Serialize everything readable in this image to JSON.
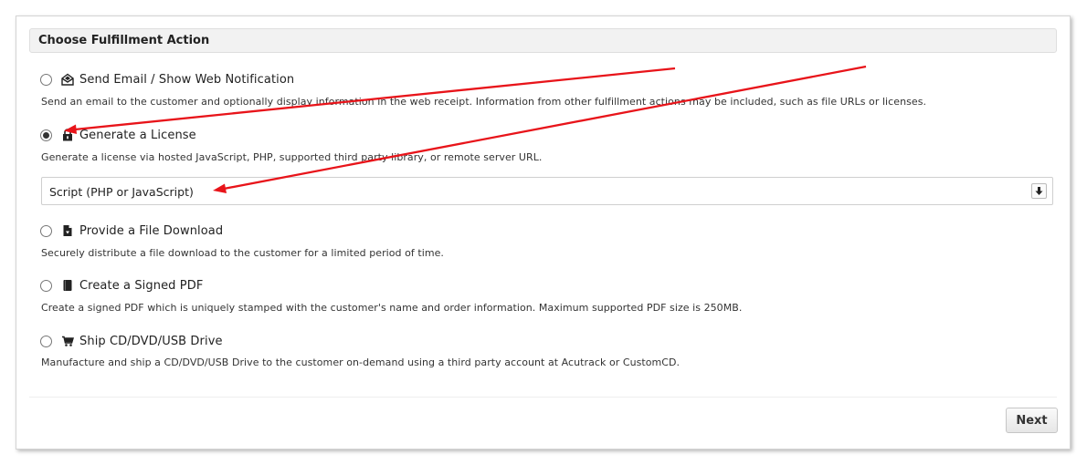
{
  "panel": {
    "title": "Choose Fulfillment Action"
  },
  "options": [
    {
      "label": "Send Email / Show Web Notification",
      "description": "Send an email to the customer and optionally display information in the web receipt. Information from other fulfillment actions may be included, such as file URLs or licenses.",
      "icon": "envelope-icon",
      "selected": false
    },
    {
      "label": "Generate a License",
      "description": "Generate a license via hosted JavaScript, PHP, supported third party library, or remote server URL.",
      "icon": "lock-icon",
      "selected": true
    },
    {
      "label": "Provide a File Download",
      "description": "Securely distribute a file download to the customer for a limited period of time.",
      "icon": "file-icon",
      "selected": false
    },
    {
      "label": "Create a Signed PDF",
      "description": "Create a signed PDF which is uniquely stamped with the customer's name and order information. Maximum supported PDF size is 250MB.",
      "icon": "book-icon",
      "selected": false
    },
    {
      "label": "Ship CD/DVD/USB Drive",
      "description": "Manufacture and ship a CD/DVD/USB Drive to the customer on-demand using a third party account at Acutrack or CustomCD.",
      "icon": "cart-icon",
      "selected": false
    }
  ],
  "license_type_select": {
    "value": "Script (PHP or JavaScript)",
    "icon": "arrow-down-icon"
  },
  "footer": {
    "next_label": "Next"
  },
  "colors": {
    "annotation_arrow": "#e8141a",
    "selected_radio_dot": "#333333"
  }
}
